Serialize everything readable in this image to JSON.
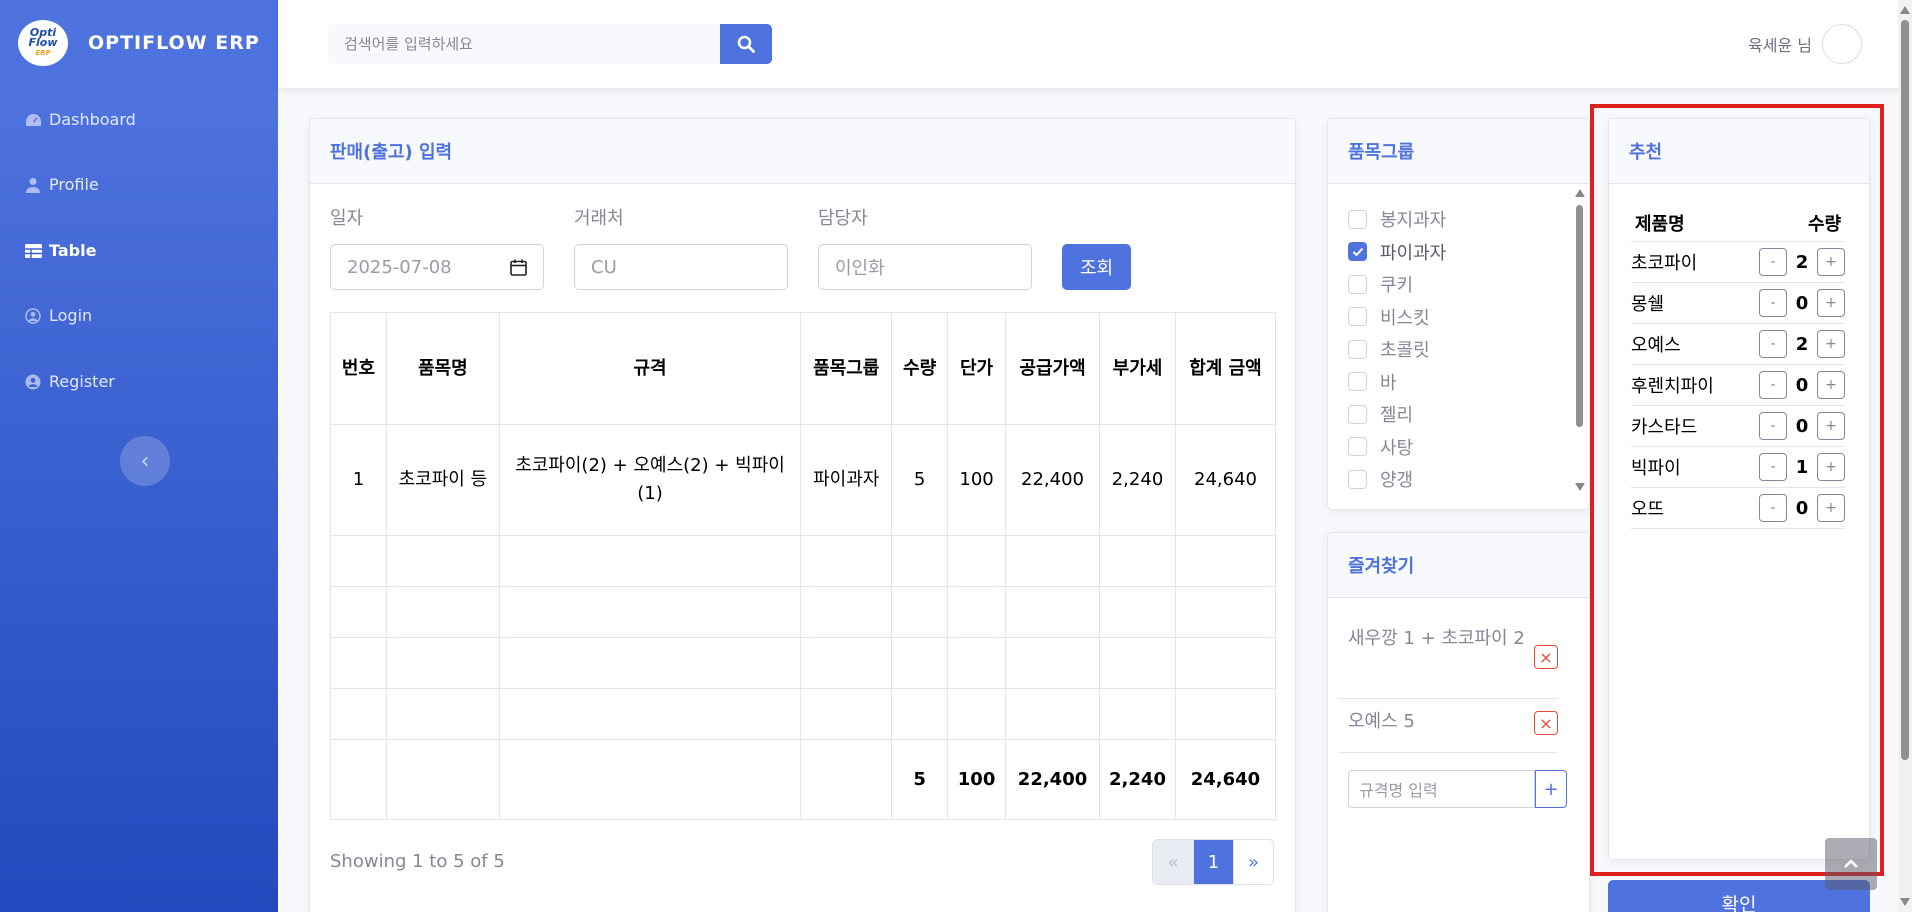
{
  "brand": {
    "name": "OPTIFLOW ERP",
    "logo_text": "Opti Flow",
    "logo_sub": "ERP"
  },
  "sidebar": {
    "items": [
      {
        "label": "Dashboard",
        "icon": "tachometer-icon"
      },
      {
        "label": "Profile",
        "icon": "user-icon"
      },
      {
        "label": "Table",
        "icon": "table-icon"
      },
      {
        "label": "Login",
        "icon": "user-circle-icon"
      },
      {
        "label": "Register",
        "icon": "user-circle-fill-icon"
      }
    ],
    "active": "Table",
    "toggle": "‹"
  },
  "topbar": {
    "search_placeholder": "검색어를 입력하세요",
    "user_name": "육세윤 님"
  },
  "sales": {
    "title": "판매(출고) 입력",
    "date_label": "일자",
    "date_value": "2025-07-08",
    "client_label": "거래처",
    "client_placeholder": "CU",
    "manager_label": "담당자",
    "manager_placeholder": "이인화",
    "search_btn": "조회",
    "columns": [
      "번호",
      "품목명",
      "규격",
      "품목그룹",
      "수량",
      "단가",
      "공급가액",
      "부가세",
      "합계 금액"
    ],
    "rows": [
      [
        "1",
        "초코파이 등",
        "초코파이(2) + 오예스(2) + 빅파이(1)",
        "파이과자",
        "5",
        "100",
        "22,400",
        "2,240",
        "24,640"
      ]
    ],
    "totals": [
      "",
      "",
      "",
      "",
      "5",
      "100",
      "22,400",
      "2,240",
      "24,640"
    ],
    "showing": "Showing 1 to 5 of 5",
    "pager": {
      "prev": "«",
      "page": "1",
      "next": "»"
    }
  },
  "item_group": {
    "title": "품목그룹",
    "items": [
      {
        "label": "봉지과자",
        "checked": false
      },
      {
        "label": "파이과자",
        "checked": true
      },
      {
        "label": "쿠키",
        "checked": false
      },
      {
        "label": "비스킷",
        "checked": false
      },
      {
        "label": "초콜릿",
        "checked": false
      },
      {
        "label": "바",
        "checked": false
      },
      {
        "label": "젤리",
        "checked": false
      },
      {
        "label": "사탕",
        "checked": false
      },
      {
        "label": "양갱",
        "checked": false
      }
    ]
  },
  "favorites": {
    "title": "즐겨찾기",
    "items": [
      "새우깡 1 + 초코파이 2",
      "오예스 5"
    ],
    "input_placeholder": "규격명 입력",
    "add_btn": "+",
    "remove_btn": "×"
  },
  "recommend": {
    "title": "추천",
    "col_name": "제품명",
    "col_qty": "수량",
    "items": [
      {
        "name": "초코파이",
        "qty": "2"
      },
      {
        "name": "몽쉘",
        "qty": "0"
      },
      {
        "name": "오예스",
        "qty": "2"
      },
      {
        "name": "후렌치파이",
        "qty": "0"
      },
      {
        "name": "카스타드",
        "qty": "0"
      },
      {
        "name": "빅파이",
        "qty": "1"
      },
      {
        "name": "오뜨",
        "qty": "0"
      }
    ],
    "minus": "-",
    "plus": "+",
    "confirm_btn": "확인"
  },
  "colors": {
    "primary": "#4e73df",
    "highlight_border": "#e02020",
    "danger": "#e74a3b"
  }
}
